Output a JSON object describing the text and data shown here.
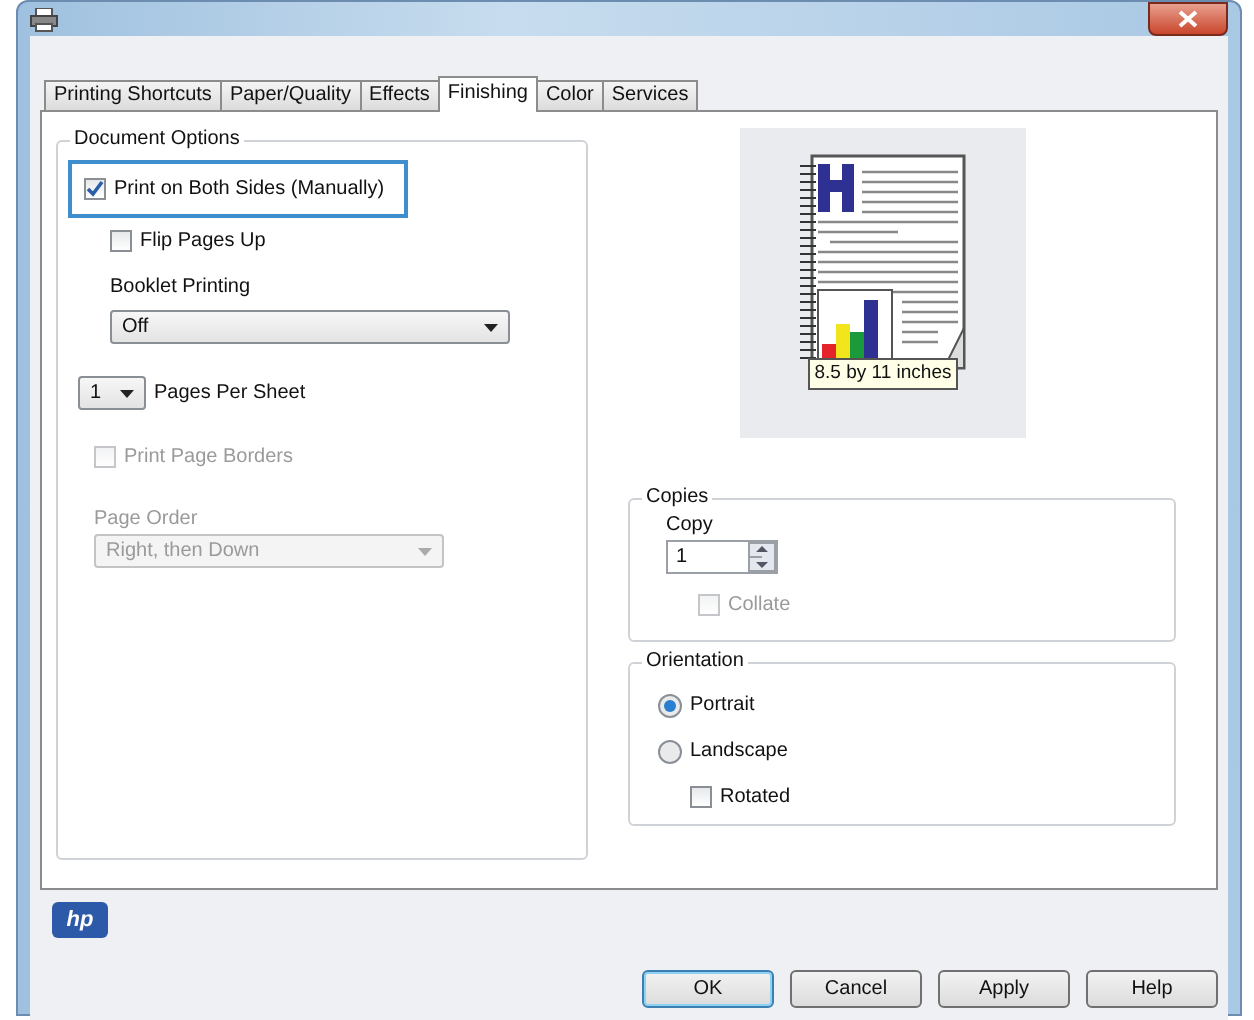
{
  "tabs": [
    {
      "label": "Printing Shortcuts",
      "selected": false
    },
    {
      "label": "Paper/Quality",
      "selected": false
    },
    {
      "label": "Effects",
      "selected": false
    },
    {
      "label": "Finishing",
      "selected": true
    },
    {
      "label": "Color",
      "selected": false
    },
    {
      "label": "Services",
      "selected": false
    }
  ],
  "document_options": {
    "title": "Document Options",
    "duplex": {
      "label": "Print on Both Sides (Manually)",
      "checked": true,
      "highlighted": true
    },
    "flip_pages_up": {
      "label": "Flip Pages Up",
      "checked": false
    },
    "booklet_printing": {
      "label": "Booklet Printing",
      "value": "Off"
    },
    "pages_per_sheet": {
      "value": "1",
      "label": "Pages Per Sheet"
    },
    "print_page_borders": {
      "label": "Print Page Borders",
      "checked": false,
      "disabled": true
    },
    "page_order": {
      "label": "Page Order",
      "value": "Right, then Down",
      "disabled": true
    }
  },
  "preview": {
    "size_label": "8.5 by 11 inches"
  },
  "copies": {
    "title": "Copies",
    "copy_label": "Copy",
    "value": "1",
    "collate": {
      "label": "Collate",
      "checked": false,
      "disabled": true
    }
  },
  "orientation": {
    "title": "Orientation",
    "options": [
      {
        "label": "Portrait",
        "selected": true
      },
      {
        "label": "Landscape",
        "selected": false
      }
    ],
    "rotated": {
      "label": "Rotated",
      "checked": false
    }
  },
  "logo": {
    "text": "hp"
  },
  "buttons": [
    {
      "label": "OK",
      "default": true
    },
    {
      "label": "Cancel",
      "default": false
    },
    {
      "label": "Apply",
      "default": false
    },
    {
      "label": "Help",
      "default": false
    }
  ]
}
